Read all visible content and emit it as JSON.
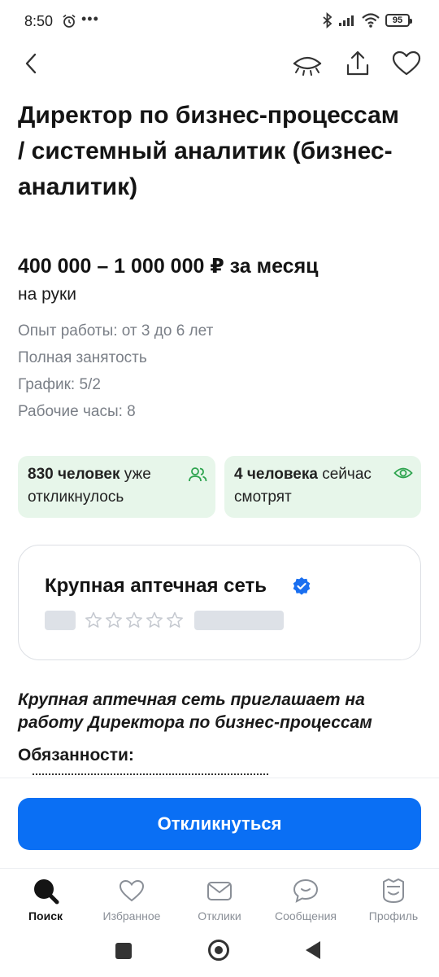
{
  "status_bar": {
    "time": "8:50",
    "battery": "95",
    "icons": [
      "alarm-icon",
      "more-dots-icon",
      "bluetooth-icon",
      "signal-icon",
      "wifi-icon",
      "battery-icon"
    ]
  },
  "nav": {
    "icons": [
      "back-arrow-icon",
      "hide-eye-icon",
      "share-icon",
      "heart-icon"
    ]
  },
  "vacancy": {
    "title": "Директор по бизнес-процессам / системный аналитик (бизнес-аналитик)",
    "salary": "400 000 – 1 000 000 ₽ за месяц",
    "salary_note": "на руки",
    "details": [
      "Опыт работы: от 3 до 6 лет",
      "Полная занятость",
      "График: 5/2",
      "Рабочие часы: 8"
    ]
  },
  "stats": {
    "responded_count": "830 человек",
    "responded_rest": "уже откликнулось",
    "viewing_count": "4 человека",
    "viewing_rest": "сейчас смотрят"
  },
  "company": {
    "name": "Крупная аптечная сеть",
    "verified_icon": "verified-badge-icon",
    "rating_stars": 5
  },
  "description": {
    "intro": "Крупная аптечная сеть приглашает на работу Директора по бизнес-процессам",
    "duties_heading": "Обязанности:"
  },
  "apply_button": "Откликнуться",
  "tabs": [
    {
      "label": "Поиск",
      "icon": "search-icon",
      "active": true
    },
    {
      "label": "Избранное",
      "icon": "heart-icon",
      "active": false
    },
    {
      "label": "Отклики",
      "icon": "envelope-icon",
      "active": false
    },
    {
      "label": "Сообщения",
      "icon": "chat-bubble-icon",
      "active": false
    },
    {
      "label": "Профиль",
      "icon": "profile-face-icon",
      "active": false
    }
  ],
  "colors": {
    "accent": "#0a6ff4",
    "stat_bg": "#e7f6ea",
    "stat_icon": "#2ea44f",
    "verified": "#1a6ff0",
    "secondary_text": "#7a7f87"
  }
}
